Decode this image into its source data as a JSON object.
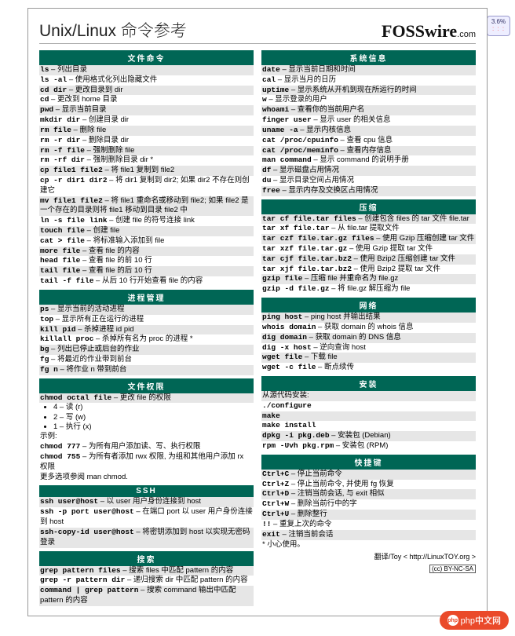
{
  "zoom": "3.6%",
  "title": "Unix/Linux 命令参考",
  "brand": "FOSSwire",
  "brand_suffix": ".com",
  "left": [
    {
      "h": "文件命令",
      "rows": [
        {
          "c": "ls",
          "d": "– 列出目录"
        },
        {
          "c": "ls -al",
          "d": "– 使用格式化列出隐藏文件"
        },
        {
          "c": "cd dir",
          "d": "– 更改目录到 dir"
        },
        {
          "c": "cd",
          "d": "– 更改到 home 目录"
        },
        {
          "c": "pwd",
          "d": "– 显示当前目录"
        },
        {
          "c": "mkdir dir",
          "d": "– 创建目录 dir"
        },
        {
          "c": "rm file",
          "d": "– 删除 file"
        },
        {
          "c": "rm -r dir",
          "d": "– 删除目录 dir"
        },
        {
          "c": "rm -f file",
          "d": "– 强制删除 file"
        },
        {
          "c": "rm -rf dir",
          "d": "– 强制删除目录 dir *"
        },
        {
          "c": "cp file1 file2",
          "d": "– 将 file1 复制到 file2"
        },
        {
          "c": "cp -r dir1 dir2",
          "d": "– 将 dir1 复制到 dir2; 如果 dir2 不存在则创建它"
        },
        {
          "c": "mv file1 file2",
          "d": "– 将 file1 重命名或移动到 file2; 如果 file2 是一个存在的目录则将 file1 移动到目录 file2 中"
        },
        {
          "c": "ln -s file link",
          "d": "– 创建 file 的符号连接 link"
        },
        {
          "c": "touch file",
          "d": "– 创建 file"
        },
        {
          "c": "cat > file",
          "d": "– 将标准输入添加到 file"
        },
        {
          "c": "more file",
          "d": "– 查看 file 的内容"
        },
        {
          "c": "head file",
          "d": "– 查看 file 的前 10 行"
        },
        {
          "c": "tail file",
          "d": "– 查看 file 的后 10 行"
        },
        {
          "c": "tail -f file",
          "d": "– 从后 10 行开始查看 file 的内容"
        }
      ]
    },
    {
      "h": "进程管理",
      "rows": [
        {
          "c": "ps",
          "d": "– 显示当前的活动进程"
        },
        {
          "c": "top",
          "d": "– 显示所有正在运行的进程"
        },
        {
          "c": "kill pid",
          "d": "– 杀掉进程 id pid"
        },
        {
          "c": "killall proc",
          "d": "– 杀掉所有名为 proc 的进程 *"
        },
        {
          "c": "bg",
          "d": "– 列出已停止或后台的作业"
        },
        {
          "c": "fg",
          "d": "– 将最近的作业带到前台"
        },
        {
          "c": "fg n",
          "d": "– 将作业 n 带到前台"
        }
      ]
    },
    {
      "h": "文件权限",
      "rows": [
        {
          "c": "chmod octal file",
          "d": "– 更改 file 的权限"
        }
      ],
      "perms": [
        "4 – 读 (r)",
        "2 – 写 (w)",
        "1 – 执行 (x)"
      ],
      "extra": [
        {
          "c": "",
          "d": "示例:"
        },
        {
          "c": "chmod 777",
          "d": "– 为所有用户添加读、写、执行权限"
        },
        {
          "c": "chmod 755",
          "d": "– 为所有者添加 rwx 权限, 为组和其他用户添加 rx 权限"
        },
        {
          "c": "",
          "d": "更多选项参阅 man chmod."
        }
      ]
    },
    {
      "h": "SSH",
      "rows": [
        {
          "c": "ssh user@host",
          "d": "– 以 user 用户身份连接到 host"
        },
        {
          "c": "ssh -p port user@host",
          "d": "– 在端口 port 以 user 用户身份连接到 host"
        },
        {
          "c": "ssh-copy-id user@host",
          "d": "– 将密钥添加到 host 以实现无密码登录"
        }
      ]
    },
    {
      "h": "搜索",
      "rows": [
        {
          "c": "grep pattern files",
          "d": "– 搜索 files 中匹配 pattern 的内容"
        },
        {
          "c": "grep -r pattern dir",
          "d": "– 递归搜索 dir 中匹配 pattern 的内容"
        },
        {
          "c": "command | grep pattern",
          "d": "– 搜索 command 输出中匹配 pattern 的内容"
        }
      ]
    }
  ],
  "right": [
    {
      "h": "系统信息",
      "rows": [
        {
          "c": "date",
          "d": "– 显示当前日期和时间"
        },
        {
          "c": "cal",
          "d": "– 显示当月的日历"
        },
        {
          "c": "uptime",
          "d": "– 显示系统从开机到现在所运行的时间"
        },
        {
          "c": "w",
          "d": "– 显示登录的用户"
        },
        {
          "c": "whoami",
          "d": "– 查看你的当前用户名"
        },
        {
          "c": "finger user",
          "d": "– 显示 user 的相关信息"
        },
        {
          "c": "uname -a",
          "d": "– 显示内核信息"
        },
        {
          "c": "cat /proc/cpuinfo",
          "d": "– 查看 cpu 信息"
        },
        {
          "c": "cat /proc/meminfo",
          "d": "– 查看内存信息"
        },
        {
          "c": "man command",
          "d": "– 显示 command 的说明手册"
        },
        {
          "c": "df",
          "d": "– 显示磁盘占用情况"
        },
        {
          "c": "du",
          "d": "– 显示目录空间占用情况"
        },
        {
          "c": "free",
          "d": "– 显示内存及交换区占用情况"
        }
      ]
    },
    {
      "h": "压缩",
      "rows": [
        {
          "c": "tar cf file.tar files",
          "d": "– 创建包含 files 的 tar 文件 file.tar"
        },
        {
          "c": "tar xf file.tar",
          "d": "– 从 file.tar 提取文件"
        },
        {
          "c": "tar czf file.tar.gz files",
          "d": "– 使用 Gzip 压缩创建 tar 文件"
        },
        {
          "c": "tar xzf file.tar.gz",
          "d": "– 使用 Gzip 提取 tar 文件"
        },
        {
          "c": "tar cjf file.tar.bz2",
          "d": "– 使用 Bzip2 压缩创建 tar 文件"
        },
        {
          "c": "tar xjf file.tar.bz2",
          "d": "– 使用 Bzip2 提取 tar 文件"
        },
        {
          "c": "gzip file",
          "d": "– 压缩 file 并重命名为 file.gz"
        },
        {
          "c": "gzip -d file.gz",
          "d": "– 将 file.gz 解压缩为 file"
        }
      ]
    },
    {
      "h": "网络",
      "rows": [
        {
          "c": "ping host",
          "d": "– ping host 并输出结果"
        },
        {
          "c": "whois domain",
          "d": "– 获取 domain 的 whois 信息"
        },
        {
          "c": "dig domain",
          "d": "– 获取 domain 的 DNS 信息"
        },
        {
          "c": "dig -x host",
          "d": "– 逆向查询 host"
        },
        {
          "c": "wget file",
          "d": "– 下载 file"
        },
        {
          "c": "wget -c file",
          "d": "– 断点续传"
        }
      ]
    },
    {
      "h": "安装",
      "rows": [
        {
          "c": "",
          "d": "从源代码安装:"
        },
        {
          "c": "./configure",
          "d": ""
        },
        {
          "c": "make",
          "d": ""
        },
        {
          "c": "make install",
          "d": ""
        },
        {
          "c": "dpkg -i pkg.deb",
          "d": "– 安装包 (Debian)"
        },
        {
          "c": "rpm -Uvh pkg.rpm",
          "d": "– 安装包 (RPM)"
        }
      ]
    },
    {
      "h": "快捷键",
      "rows": [
        {
          "c": "Ctrl+C",
          "d": "– 停止当前命令"
        },
        {
          "c": "Ctrl+Z",
          "d": "– 停止当前命令, 并使用 fg 恢复"
        },
        {
          "c": "Ctrl+D",
          "d": "– 注销当前会话, 与 exit 相似"
        },
        {
          "c": "Ctrl+W",
          "d": "– 删除当前行中的字"
        },
        {
          "c": "Ctrl+U",
          "d": "– 删除整行"
        },
        {
          "c": "!!",
          "d": "– 重复上次的命令"
        },
        {
          "c": "exit",
          "d": "– 注销当前会话"
        }
      ]
    }
  ],
  "footnote": "* 小心使用。",
  "translator": "翻译/Toy < http://LinuxTOY.org >",
  "cc": "(cc) BY-NC-SA",
  "watermark": "php中文网"
}
